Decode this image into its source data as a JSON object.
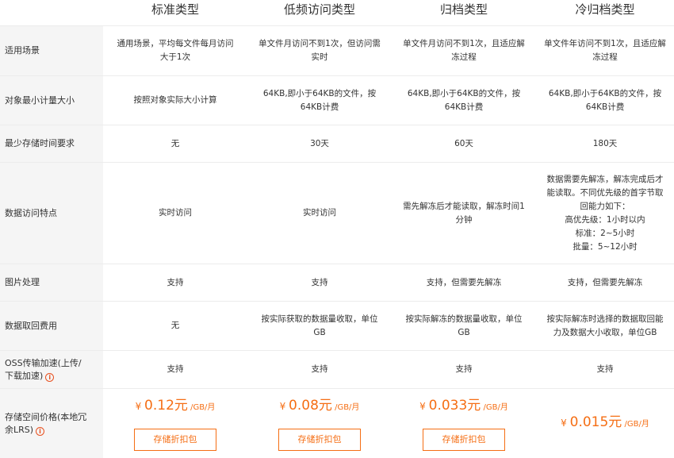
{
  "columns": [
    "标准类型",
    "低频访问类型",
    "归档类型",
    "冷归档类型"
  ],
  "rows": [
    {
      "label": "适用场景",
      "cells": [
        [
          "通用场景，平均每文件每月访问",
          "大于1次"
        ],
        [
          "单文件月访问不到1次，但访问需",
          "实时"
        ],
        [
          "单文件月访问不到1次，且适应解",
          "冻过程"
        ],
        [
          "单文件年访问不到1次，且适应解",
          "冻过程"
        ]
      ]
    },
    {
      "label": "对象最小计量大小",
      "cells": [
        [
          "按照对象实际大小计算"
        ],
        [
          "64KB,即小于64KB的文件，按",
          "64KB计费"
        ],
        [
          "64KB,即小于64KB的文件，按",
          "64KB计费"
        ],
        [
          "64KB,即小于64KB的文件，按",
          "64KB计费"
        ]
      ]
    },
    {
      "label": "最少存储时间要求",
      "cells": [
        [
          "无"
        ],
        [
          "30天"
        ],
        [
          "60天"
        ],
        [
          "180天"
        ]
      ]
    },
    {
      "label": "数据访问特点",
      "cells": [
        [
          "实时访问"
        ],
        [
          "实时访问"
        ],
        [
          "需先解冻后才能读取，解冻时间1",
          "分钟"
        ],
        [
          "数据需要先解冻，解冻完成后才",
          "能读取。不同优先级的首字节取",
          "回能力如下：",
          "高优先级：1小时以内",
          "标准：2~5小时",
          "批量：5~12小时"
        ]
      ]
    },
    {
      "label": "图片处理",
      "cells": [
        [
          "支持"
        ],
        [
          "支持"
        ],
        [
          "支持，但需要先解冻"
        ],
        [
          "支持，但需要先解冻"
        ]
      ]
    },
    {
      "label": "数据取回费用",
      "cells": [
        [
          "无"
        ],
        [
          "按实际获取的数据量收取，单位",
          "GB"
        ],
        [
          "按实际解冻的数据量收取，单位",
          "GB"
        ],
        [
          "按实际解冻时选择的数据取回能",
          "力及数据大小收取，单位GB"
        ]
      ]
    },
    {
      "label_lines": [
        "OSS传输加速(上传/",
        "下载加速)"
      ],
      "cells": [
        [
          "支持"
        ],
        [
          "支持"
        ],
        [
          "支持"
        ],
        [
          "支持"
        ]
      ]
    }
  ],
  "price_row": {
    "label_lines": [
      "存储空间价格(本地冗",
      "余LRS)"
    ],
    "currency": "¥",
    "unit": "/GB/月",
    "prices": [
      "0.12元",
      "0.08元",
      "0.033元",
      "0.015元"
    ],
    "button_label": "存储折扣包"
  },
  "colors": {
    "accent": "#f56e14",
    "label_bg": "#f5f5f5"
  },
  "icons": {
    "info": "info-circle-icon"
  }
}
